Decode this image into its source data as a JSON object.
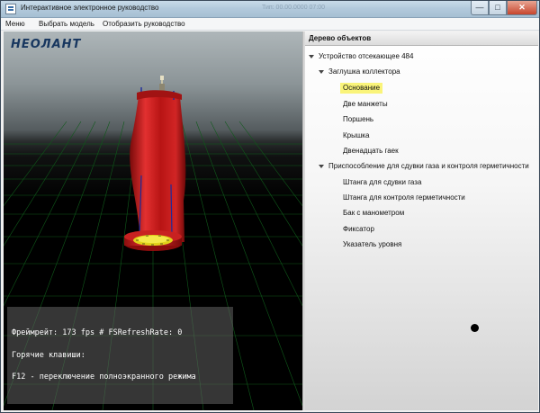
{
  "window": {
    "title": "Интерактивное электронное руководство",
    "ghost_title": "Тип: 00.00.0000 07:00",
    "controls": {
      "minimize": "—",
      "maximize": "□",
      "close": "✕"
    }
  },
  "menu": {
    "items": [
      "Меню",
      "Выбрать модель",
      "Отобразить руководство"
    ]
  },
  "viewport": {
    "logo": "НЕОЛАНТ",
    "overlay": {
      "framerate": "Фреймрейт: 173 fps # FSRefreshRate: 0",
      "hotkeys_title": "Горячие клавиши:",
      "hotkey_f12": "F12 - переключение полноэкранного режима"
    }
  },
  "object_tree": {
    "title": "Дерево объектов",
    "root": "Устройство отсекающее 484",
    "group1": {
      "label": "Заглушка коллектора",
      "items": [
        "Основание",
        "Две манжеты",
        "Поршень",
        "Крышка",
        "Двенадцать гаек"
      ]
    },
    "group2": {
      "label": "Приспособление для сдувки газа и контроля герметичности",
      "items": [
        "Штанга для сдувки газа",
        "Штанга для контроля герметичности",
        "Бак с манометром",
        "Фиксатор",
        "Указатель уровня"
      ]
    },
    "selected": "Основание"
  },
  "colors": {
    "model_body": "#c41a1a",
    "model_base": "#e0d21a",
    "grid": "#0f5a1a",
    "selection": "#faf47a",
    "logo": "#17365f"
  },
  "icons": {
    "app": "app-window-icon",
    "expand": "expand-arrow-icon"
  }
}
